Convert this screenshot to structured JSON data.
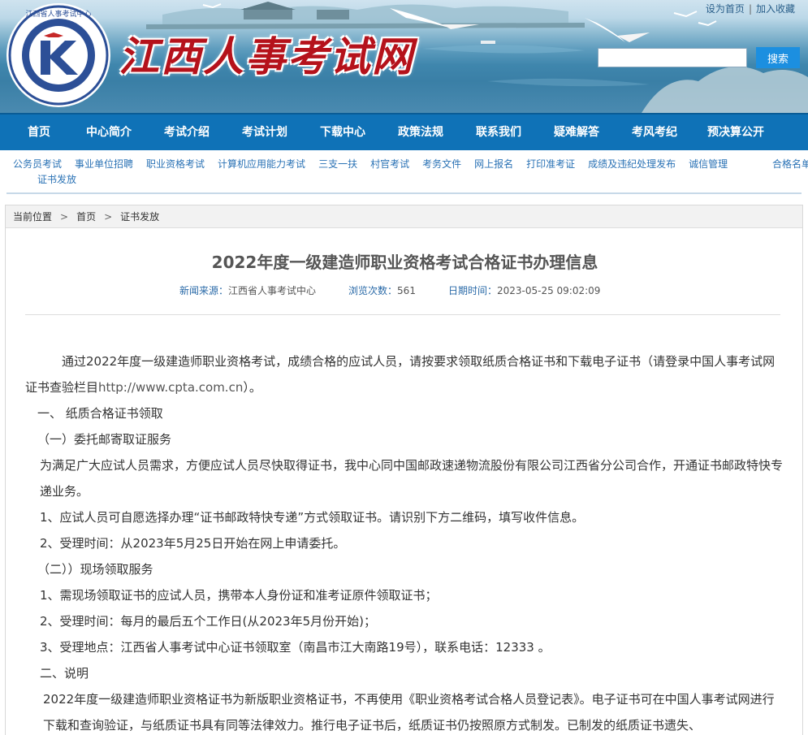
{
  "header": {
    "site_title": "江西人事考试网",
    "logo_text": "江西省人事考试中心",
    "set_homepage": "设为首页",
    "separator": "|",
    "add_favorite": "加入收藏",
    "search_placeholder": "",
    "search_button": "搜索"
  },
  "main_nav": [
    "首页",
    "中心简介",
    "考试介绍",
    "考试计划",
    "下载中心",
    "政策法规",
    "联系我们",
    "疑难解答",
    "考风考纪",
    "预决算公开"
  ],
  "sub_nav": [
    "公务员考试",
    "事业单位招聘",
    "职业资格考试",
    "计算机应用能力考试",
    "三支一扶",
    "村官考试",
    "考务文件",
    "网上报名",
    "打印准考证",
    "成绩及违纪处理发布",
    "诚信管理",
    "合格名单",
    "证书发放"
  ],
  "breadcrumb": {
    "label": "当前位置",
    "arrow": ">",
    "home": "首页",
    "current": "证书发放"
  },
  "article": {
    "title": "2022年度一级建造师职业资格考试合格证书办理信息",
    "source_label": "新闻来源：",
    "source_value": "江西省人事考试中心",
    "views_label": "浏览次数：",
    "views_value": "561",
    "date_label": "日期时间：",
    "date_value": "2023-05-25 09:02:09",
    "para1_a": "通过2022年度一级建造师职业资格考试，成绩合格的应试人员，请按要求领取纸质合格证书和下载电子证书（请登录中国人事考试网证书查验栏目",
    "para1_url": "http://www.cpta.com.cn",
    "para1_b": "）。",
    "section1": "一、 纸质合格证书领取",
    "sub1": "（一）委托邮寄取证服务",
    "para2": "为满足广大应试人员需求，方便应试人员尽快取得证书，我中心同中国邮政速递物流股份有限公司江西省分公司合作，开通证书邮政特快专递业务。",
    "item1": "1、应试人员可自愿选择办理“证书邮政特快专递”方式领取证书。请识别下方二维码，填写收件信息。",
    "item2": "2、受理时间：从2023年5月25日开始在网上申请委托。",
    "sub2": "（二））现场领取服务",
    "item3": "1、需现场领取证书的应试人员，携带本人身份证和准考证原件领取证书；",
    "item4": "2、受理时间：每月的最后五个工作日(从2023年5月份开始)；",
    "item5": "3、受理地点：江西省人事考试中心证书领取室（南昌市江大南路19号），联系电话：12333 。",
    "section2": "二、说明",
    "para3": "2022年度一级建造师职业资格证书为新版职业资格证书，不再使用《职业资格考试合格人员登记表》。电子证书可在中国人事考试网进行下载和查询验证，与纸质证书具有同等法律效力。推行电子证书后，纸质证书仍按照原方式制发。已制发的纸质证书遗失、"
  },
  "colors": {
    "nav_blue": "#0f72b7",
    "title_red": "#b5121b",
    "link_blue": "#2a72b5",
    "search_blue": "#1c8fe0"
  }
}
